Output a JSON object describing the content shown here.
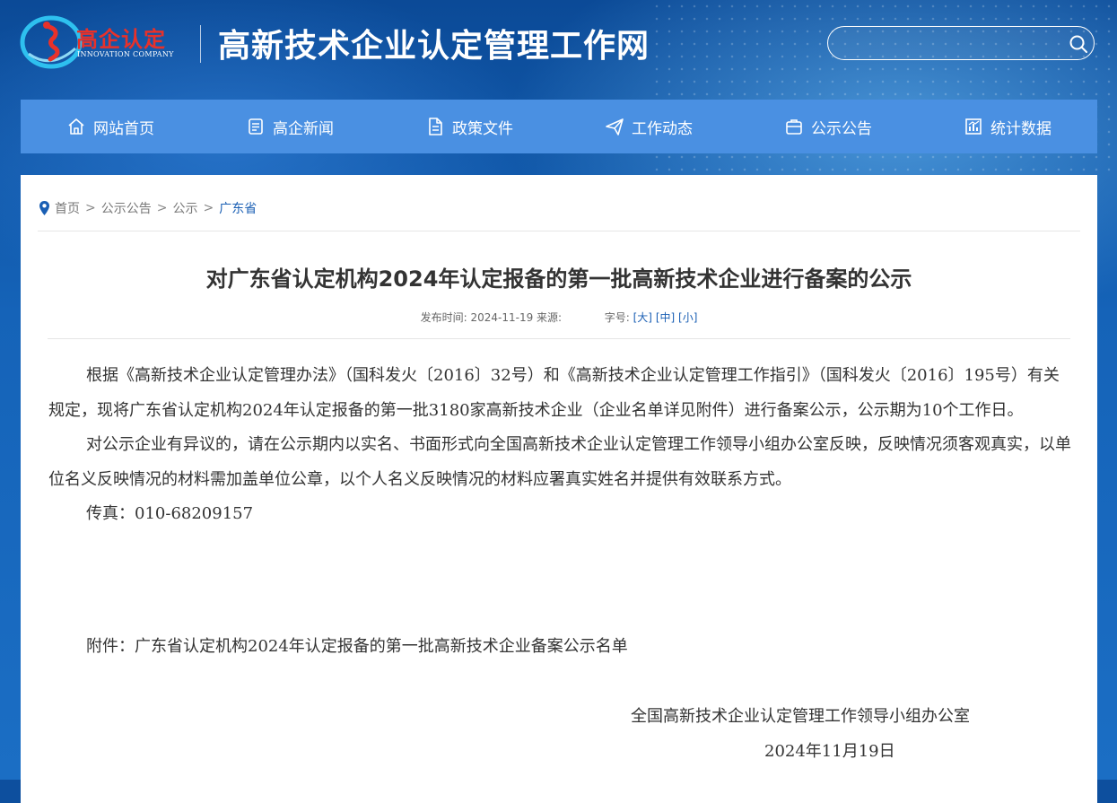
{
  "header": {
    "logo_text": "高企认定",
    "logo_sub": "INNOVATION COMPANY",
    "site_title": "高新技术企业认定管理工作网",
    "search": {
      "placeholder": "",
      "icon": "search-icon"
    }
  },
  "nav": {
    "items": [
      {
        "label": "网站首页",
        "icon": "home-icon"
      },
      {
        "label": "高企新闻",
        "icon": "news-icon"
      },
      {
        "label": "政策文件",
        "icon": "document-icon"
      },
      {
        "label": "工作动态",
        "icon": "send-icon"
      },
      {
        "label": "公示公告",
        "icon": "notice-icon"
      },
      {
        "label": "统计数据",
        "icon": "chart-icon"
      }
    ]
  },
  "breadcrumb": {
    "icon": "location-pin-icon",
    "items": [
      "首页",
      "公示公告",
      "公示",
      "广东省"
    ]
  },
  "article": {
    "title": "对广东省认定机构2024年认定报备的第一批高新技术企业进行备案的公示",
    "meta": {
      "publish_label": "发布时间:",
      "publish_date": "2024-11-19",
      "source_label": "来源:",
      "font_size_label": "字号:",
      "size_large": "[大]",
      "size_medium": "[中]",
      "size_small": "[小]"
    },
    "paragraphs": [
      "根据《高新技术企业认定管理办法》（国科发火〔2016〕32号）和《高新技术企业认定管理工作指引》（国科发火〔2016〕195号）有关规定，现将广东省认定机构2024年认定报备的第一批3180家高新技术企业（企业名单详见附件）进行备案公示，公示期为10个工作日。",
      "对公示企业有异议的，请在公示期内以实名、书面形式向全国高新技术企业认定管理工作领导小组办公室反映，反映情况须客观真实，以单位名义反映情况的材料需加盖单位公章，以个人名义反映情况的材料应署真实姓名并提供有效联系方式。",
      "传真：010-68209157"
    ],
    "attachment": "附件：广东省认定机构2024年认定报备的第一批高新技术企业备案公示名单",
    "signature": "全国高新技术企业认定管理工作领导小组办公室",
    "sign_date": "2024年11月19日"
  },
  "colors": {
    "header_bg": "#0d4f9e",
    "nav_bg": "#4a90e2",
    "logo_red": "#e8312a",
    "link_blue": "#1a5fb4"
  }
}
